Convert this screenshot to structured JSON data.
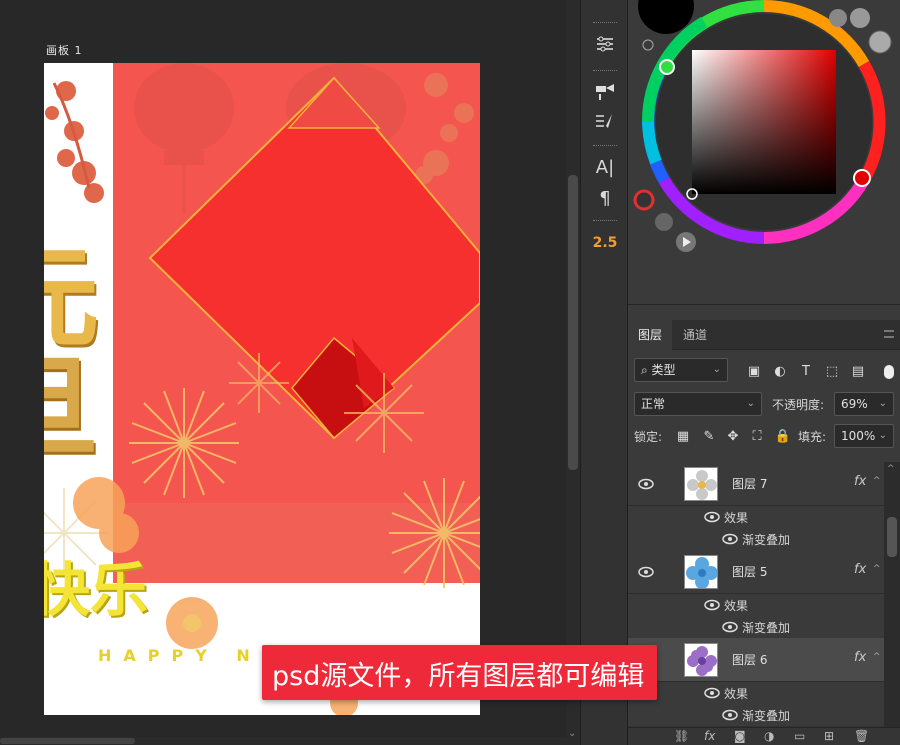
{
  "canvas": {
    "artboard_label": "画板 1",
    "poster_chars": {
      "yuan": "元",
      "dan": "旦",
      "kuaile": "快乐",
      "happy": "HAPPY N"
    }
  },
  "tools": {
    "text_tool": "A|",
    "paragraph_tool": "¶",
    "brush_size": "2.5"
  },
  "colors": {
    "accent_red": "#ee2a3a",
    "poster_red": "#f4554e",
    "diamond_red": "#f52a2a",
    "gold": "#e8b84b",
    "panel_bg": "#3a3a3a"
  },
  "layers_panel": {
    "tabs": [
      "图层",
      "通道"
    ],
    "filter_kind": "类型",
    "filter_icons": [
      "image-filter-icon",
      "adjustment-filter-icon",
      "type-filter-icon",
      "shape-filter-icon",
      "smart-object-filter-icon"
    ],
    "blend_mode": "正常",
    "opacity_label": "不透明度:",
    "opacity_value": "69%",
    "lock_label": "锁定:",
    "fill_label": "填充:",
    "fill_value": "100%",
    "layers": [
      {
        "name": "图层 7",
        "effects_label": "效果",
        "effect": "渐变叠加",
        "fx": "fx",
        "thumb_color": "#c9c9c9"
      },
      {
        "name": "图层 5",
        "effects_label": "效果",
        "effect": "渐变叠加",
        "fx": "fx",
        "thumb_color": "#5aa6e0"
      },
      {
        "name": "图层 6",
        "effects_label": "效果",
        "effect": "渐变叠加",
        "fx": "fx",
        "thumb_color": "#9b6fc8"
      }
    ],
    "footer_icons": [
      "link-icon",
      "fx-icon",
      "mask-icon",
      "adjustment-icon",
      "folder-icon",
      "new-layer-icon",
      "trash-icon"
    ],
    "footer_fx": "fx"
  },
  "banner": {
    "text": "psd源文件，所有图层都可编辑"
  }
}
